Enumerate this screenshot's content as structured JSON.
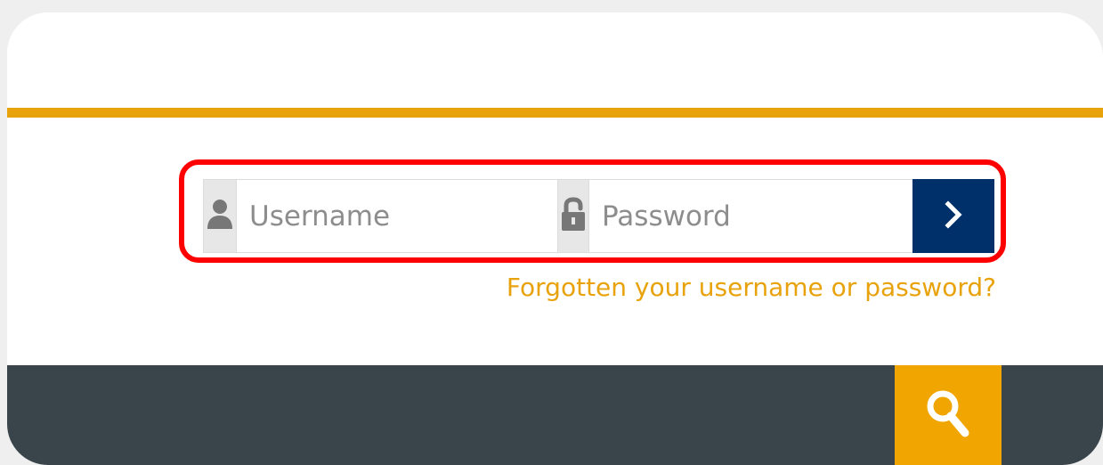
{
  "login": {
    "username_placeholder": "Username",
    "password_placeholder": "Password",
    "forgot_text": "Forgotten your username or password?"
  },
  "icons": {
    "username": "user-icon",
    "password": "unlock-icon",
    "submit": "chevron-right-icon",
    "search": "search-icon"
  },
  "colors": {
    "accent": "#e8a30c",
    "submit": "#003069",
    "footer": "#3a444b",
    "highlight": "#ff0000",
    "search": "#f0a500"
  }
}
